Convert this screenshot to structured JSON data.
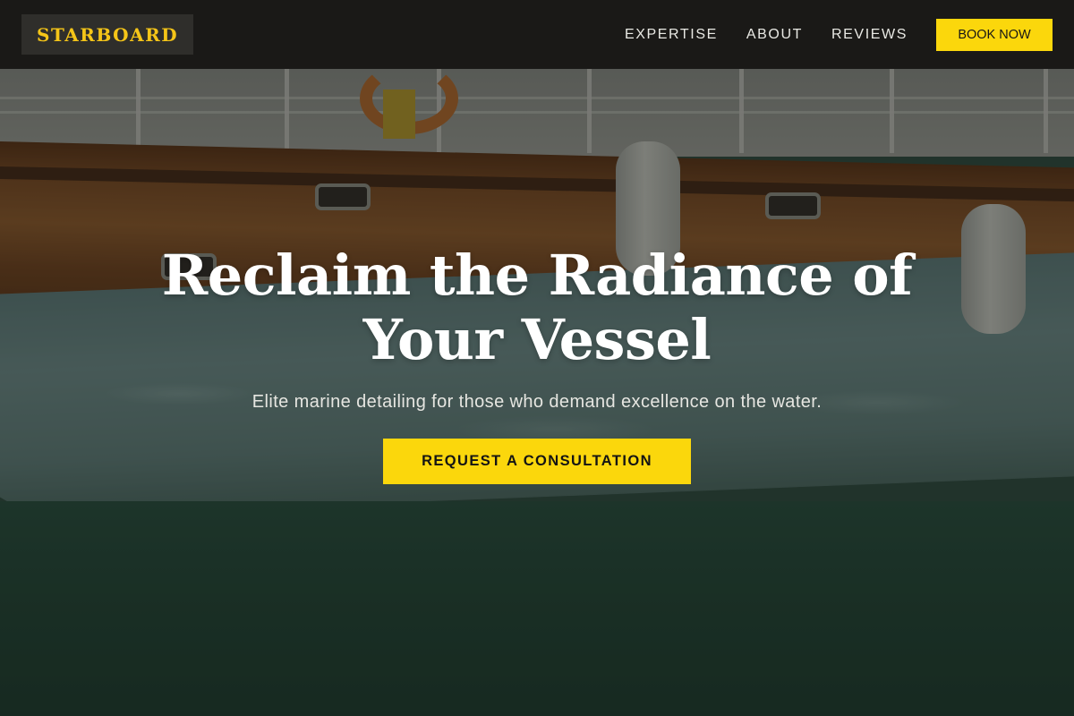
{
  "brand": {
    "logo_text": "STARBOARD",
    "accent_color": "#fbd70c"
  },
  "nav": {
    "links": [
      {
        "label": "EXPERTISE"
      },
      {
        "label": "ABOUT"
      },
      {
        "label": "REVIEWS"
      }
    ],
    "book_label": "BOOK NOW"
  },
  "hero": {
    "headline": "Reclaim the Radiance of Your Vessel",
    "subtitle": "Elite marine detailing for those who demand excellence on the water.",
    "cta_label": "REQUEST A CONSULTATION"
  }
}
